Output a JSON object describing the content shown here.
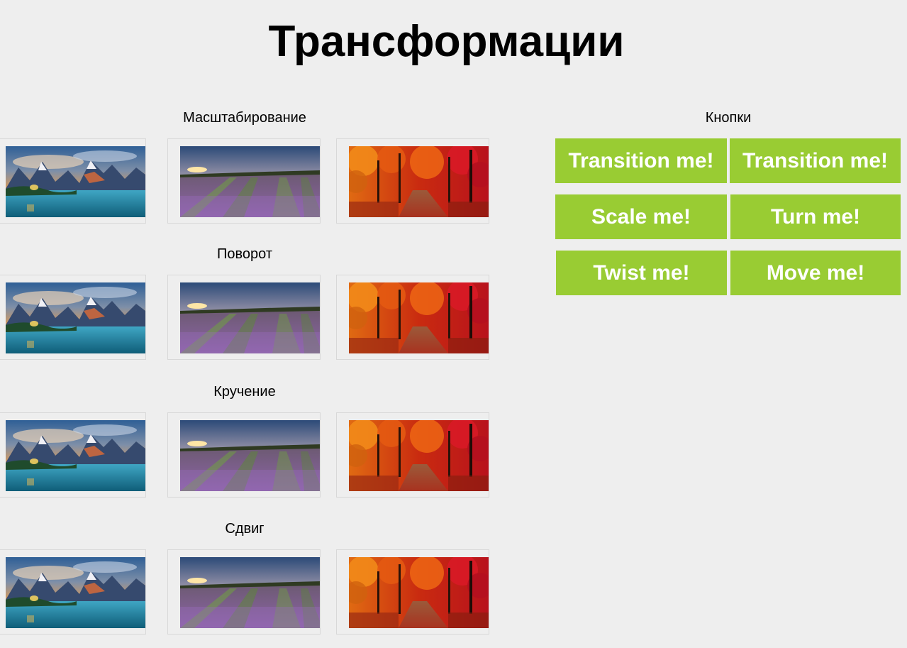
{
  "page": {
    "title": "Трансформации"
  },
  "sections": [
    {
      "title": "Масштабирование",
      "images": [
        "mountain-lake",
        "lavender-field",
        "autumn-forest"
      ]
    },
    {
      "title": "Поворот",
      "images": [
        "mountain-lake",
        "lavender-field",
        "autumn-forest"
      ]
    },
    {
      "title": "Кручение",
      "images": [
        "mountain-lake",
        "lavender-field",
        "autumn-forest"
      ]
    },
    {
      "title": "Сдвиг",
      "images": [
        "mountain-lake",
        "lavender-field",
        "autumn-forest"
      ]
    }
  ],
  "buttons_panel": {
    "title": "Кнопки",
    "buttons": [
      {
        "label": "Transition me!"
      },
      {
        "label": "Transition me!"
      },
      {
        "label": "Scale me!"
      },
      {
        "label": "Turn me!"
      },
      {
        "label": "Twist me!"
      },
      {
        "label": "Move me!"
      }
    ]
  },
  "colors": {
    "background": "#eeeeee",
    "button": "#99cc33",
    "button_text": "#ffffff"
  }
}
